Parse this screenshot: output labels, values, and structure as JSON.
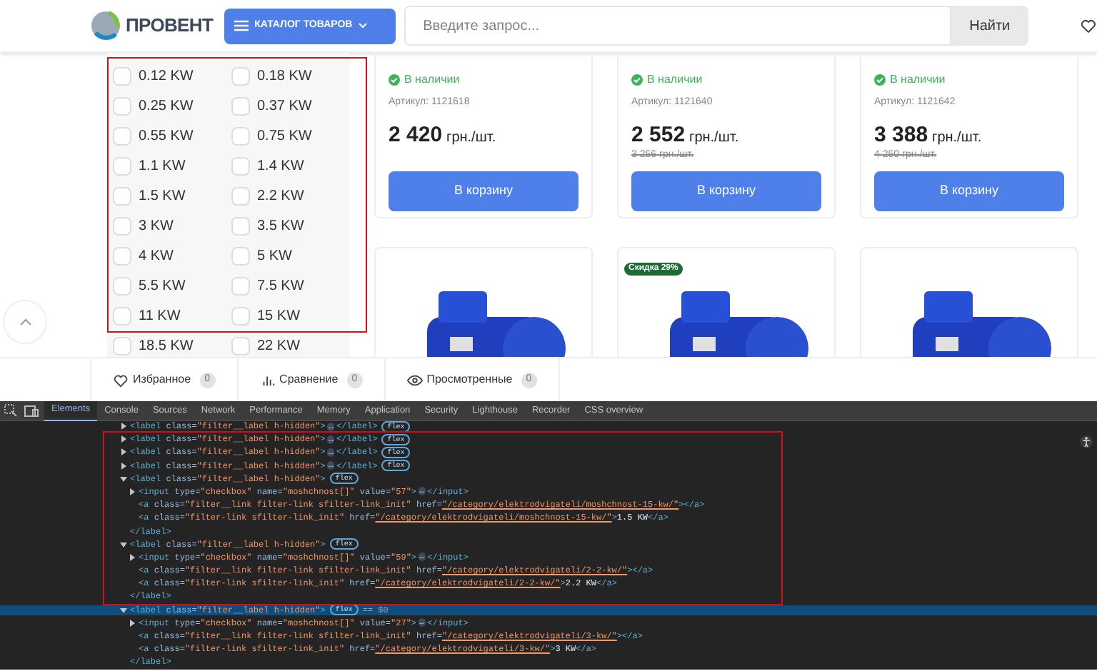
{
  "header": {
    "logo": "ПРОВЕНТ",
    "catalog_button": "КАТАЛОГ ТОВАРОВ",
    "search": {
      "placeholder": "Введите запрос..."
    },
    "search_button": "Найти"
  },
  "filter": {
    "options": [
      {
        "label": "0.12 KW",
        "checked": false
      },
      {
        "label": "0.18 KW",
        "checked": false
      },
      {
        "label": "0.25 KW",
        "checked": false
      },
      {
        "label": "0.37 KW",
        "checked": false
      },
      {
        "label": "0.55 KW",
        "checked": false
      },
      {
        "label": "0.75 KW",
        "checked": false
      },
      {
        "label": "1.1 KW",
        "checked": false
      },
      {
        "label": "1.4 KW",
        "checked": false
      },
      {
        "label": "1.5 KW",
        "checked": false
      },
      {
        "label": "2.2 KW",
        "checked": false
      },
      {
        "label": "3 KW",
        "checked": false
      },
      {
        "label": "3.5 KW",
        "checked": false
      },
      {
        "label": "4 KW",
        "checked": false
      },
      {
        "label": "5 KW",
        "checked": false
      },
      {
        "label": "5.5 KW",
        "checked": false
      },
      {
        "label": "7.5 KW",
        "checked": false
      },
      {
        "label": "11 KW",
        "checked": false
      },
      {
        "label": "15 KW",
        "checked": false
      },
      {
        "label": "18.5 KW",
        "checked": false
      },
      {
        "label": "22 KW",
        "checked": false
      }
    ]
  },
  "products": [
    {
      "stock": "В наличии",
      "article": "Артикул: 1121618",
      "price": "2 420",
      "unit": "грн./шт.",
      "button": "В корзину"
    },
    {
      "stock": "В наличии",
      "article": "Артикул: 1121640",
      "price": "2 552",
      "unit": "грн./шт.",
      "old_price": "3 256 грн./шт.",
      "button": "В корзину"
    },
    {
      "stock": "В наличии",
      "article": "Артикул: 1121642",
      "price": "3 388",
      "unit": "грн./шт.",
      "old_price": "4 250 грн./шт.",
      "button": "В корзину"
    }
  ],
  "product_images": [
    {
      "discount": false
    },
    {
      "discount": true,
      "badge": "Скидка 29%"
    },
    {
      "discount": false
    }
  ],
  "bottom_bar": [
    {
      "kind": "heart",
      "label": "Избранное",
      "count": "0"
    },
    {
      "kind": "chart",
      "label": "Сравнение",
      "count": "0"
    },
    {
      "kind": "eye",
      "label": "Просмотренные",
      "count": "0"
    }
  ],
  "devtools": {
    "tabs": [
      {
        "label": "Elements",
        "selected": true
      },
      {
        "label": "Console",
        "selected": false
      },
      {
        "label": "Sources",
        "selected": false
      },
      {
        "label": "Network",
        "selected": false
      },
      {
        "label": "Performance",
        "selected": false
      },
      {
        "label": "Memory",
        "selected": false
      },
      {
        "label": "Application",
        "selected": false
      },
      {
        "label": "Security",
        "selected": false
      },
      {
        "label": "Lighthouse",
        "selected": false
      },
      {
        "label": "Recorder",
        "selected": false
      },
      {
        "label": "CSS overview",
        "selected": false
      }
    ],
    "tree": [
      {
        "start": "<label class=\"filter__label h-hidden\">",
        "ellipsis": "…",
        "end": "</label>",
        "badge": "flex",
        "expanded": false,
        "selected": false
      },
      {
        "start": "<label class=\"filter__label h-hidden\">",
        "ellipsis": "…",
        "end": "</label>",
        "badge": "flex",
        "expanded": false,
        "selected": false
      },
      {
        "start": "<label class=\"filter__label h-hidden\">",
        "ellipsis": "…",
        "end": "</label>",
        "badge": "flex",
        "expanded": false,
        "selected": false
      },
      {
        "start": "<label class=\"filter__label h-hidden\">",
        "ellipsis": "…",
        "end": "</label>",
        "badge": "flex",
        "expanded": false,
        "selected": false
      },
      {
        "start": "<label class=\"filter__label h-hidden\">",
        "end": "</label>",
        "badge": "flex",
        "expanded": true,
        "selected": false,
        "children": [
          {
            "start": "<input type=\"checkbox\" name=\"moshchnost[]\" value=\"57\">",
            "ellipsis": "…",
            "end": "</input>",
            "expanded": false,
            "selected": false
          },
          {
            "start": "<a class=\"filter__link filter-link sfilter-link_init\" href=\"/category/elektrodvigateli/moshchnost-15-kw/\">",
            "end": "</a>",
            "selected": false
          },
          {
            "start": "<a class=\"filter-link sfilter-link_init\" href=\"/category/elektrodvigateli/moshchnost-15-kw/\">",
            "content": "1.5 KW",
            "end": "</a>",
            "selected": false
          }
        ]
      },
      {
        "start": "<label class=\"filter__label h-hidden\">",
        "end": "</label>",
        "badge": "flex",
        "expanded": true,
        "selected": false,
        "children": [
          {
            "start": "<input type=\"checkbox\" name=\"moshchnost[]\" value=\"59\">",
            "ellipsis": "…",
            "end": "</input>",
            "expanded": false,
            "selected": false
          },
          {
            "start": "<a class=\"filter__link filter-link sfilter-link_init\" href=\"/category/elektrodvigateli/2-2-kw/\">",
            "end": "</a>",
            "selected": false
          },
          {
            "start": "<a class=\"filter-link sfilter-link_init\" href=\"/category/elektrodvigateli/2-2-kw/\">",
            "content": "2.2 KW",
            "end": "</a>",
            "selected": false
          }
        ]
      },
      {
        "start": "<label class=\"filter__label h-hidden\">",
        "end": "</label>",
        "badge": "flex",
        "marker": "== $0",
        "expanded": true,
        "selected": true,
        "children": [
          {
            "start": "<input type=\"checkbox\" name=\"moshchnost[]\" value=\"27\">",
            "ellipsis": "…",
            "end": "</input>",
            "expanded": false,
            "selected": false
          },
          {
            "start": "<a class=\"filter__link filter-link sfilter-link_init\" href=\"/category/elektrodvigateli/3-kw/\">",
            "end": "</a>",
            "selected": false
          },
          {
            "start": "<a class=\"filter-link sfilter-link_init\" href=\"/category/elektrodvigateli/3-kw/\">",
            "content": "3 KW",
            "end": "</a>",
            "selected": false
          }
        ]
      }
    ]
  }
}
